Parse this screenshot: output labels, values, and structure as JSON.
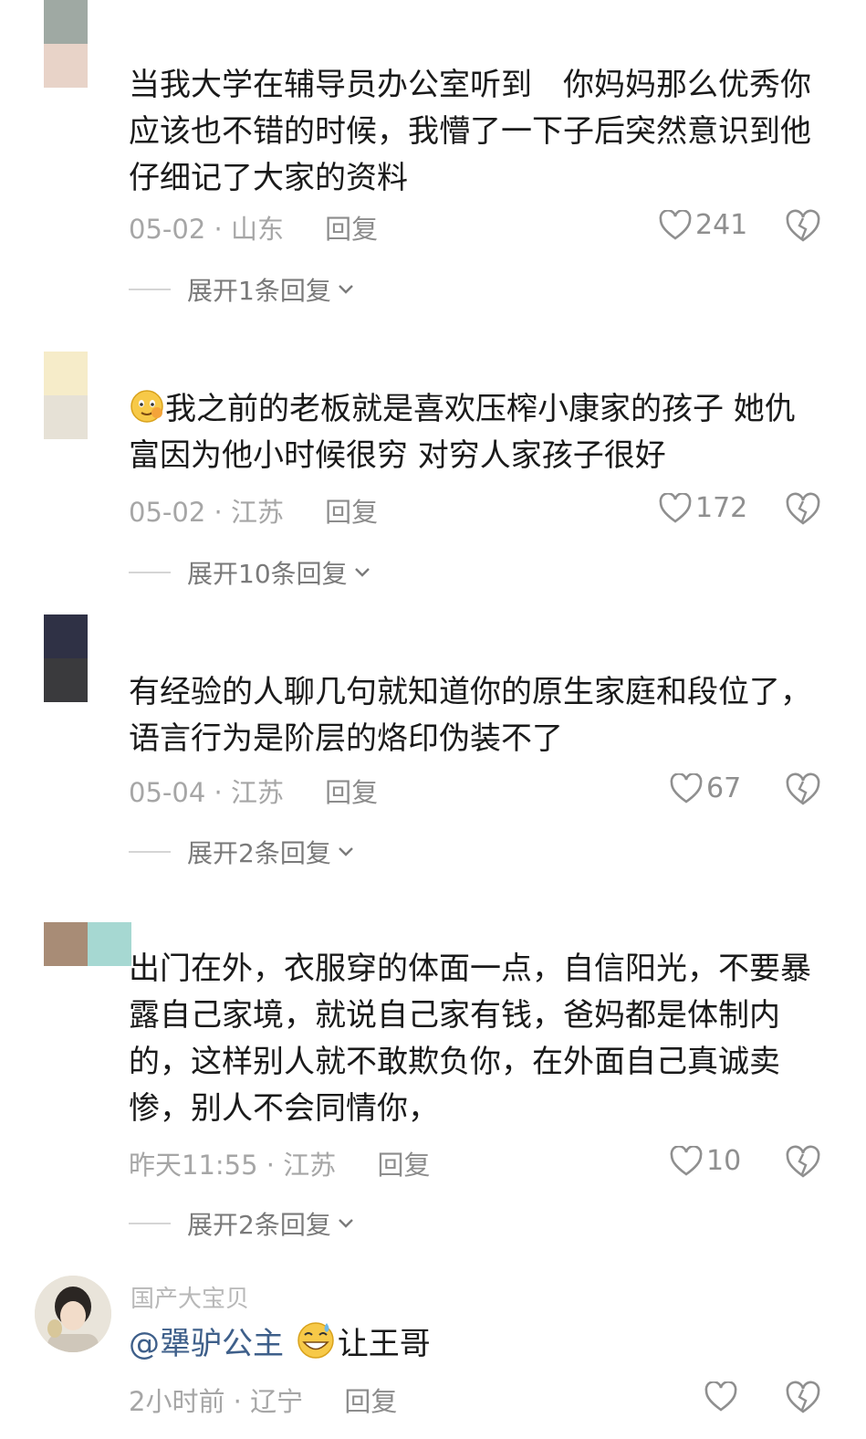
{
  "comments": [
    {
      "username": "",
      "text_lines": [
        "当我大学在辅导员办公室听到　你妈妈那么优秀你",
        "应该也不错的时候，我懵了一下子后突然意识到他",
        "仔细记了大家的资料"
      ],
      "date": "05-02",
      "location": "山东",
      "reply_label": "回复",
      "likes": "241",
      "expand_label": "展开1条回复"
    },
    {
      "username": "",
      "text_lines": [
        "我之前的老板就是喜欢压榨小康家的孩子 她仇",
        "富因为他小时候很穷 对穷人家孩子很好"
      ],
      "date": "05-02",
      "location": "江苏",
      "reply_label": "回复",
      "likes": "172",
      "expand_label": "展开10条回复"
    },
    {
      "username": "",
      "text_lines": [
        "有经验的人聊几句就知道你的原生家庭和段位了，",
        "语言行为是阶层的烙印伪装不了"
      ],
      "date": "05-04",
      "location": "江苏",
      "reply_label": "回复",
      "likes": "67",
      "expand_label": "展开2条回复"
    },
    {
      "username": "",
      "text_lines": [
        "出门在外，衣服穿的体面一点，自信阳光，不要暴",
        "露自己家境，就说自己家有钱，爸妈都是体制内",
        "的，这样别人就不敢欺负你，在外面自己真诚卖",
        "惨，别人不会同情你，"
      ],
      "date": "昨天11:55",
      "location": "江苏",
      "reply_label": "回复",
      "likes": "10",
      "expand_label": "展开2条回复"
    },
    {
      "username": "国产大宝贝",
      "mention": "@犟驴公主",
      "text_after": "让王哥",
      "date": "2小时前",
      "location": "辽宁",
      "reply_label": "回复",
      "likes": ""
    }
  ],
  "meta_separator": "·",
  "icons": {
    "like": "heart-outline-icon",
    "dislike": "broken-heart-icon",
    "expand": "chevron-down-icon"
  },
  "colors": {
    "mention": "#3e5f8a",
    "meta": "#a6a6a6"
  }
}
